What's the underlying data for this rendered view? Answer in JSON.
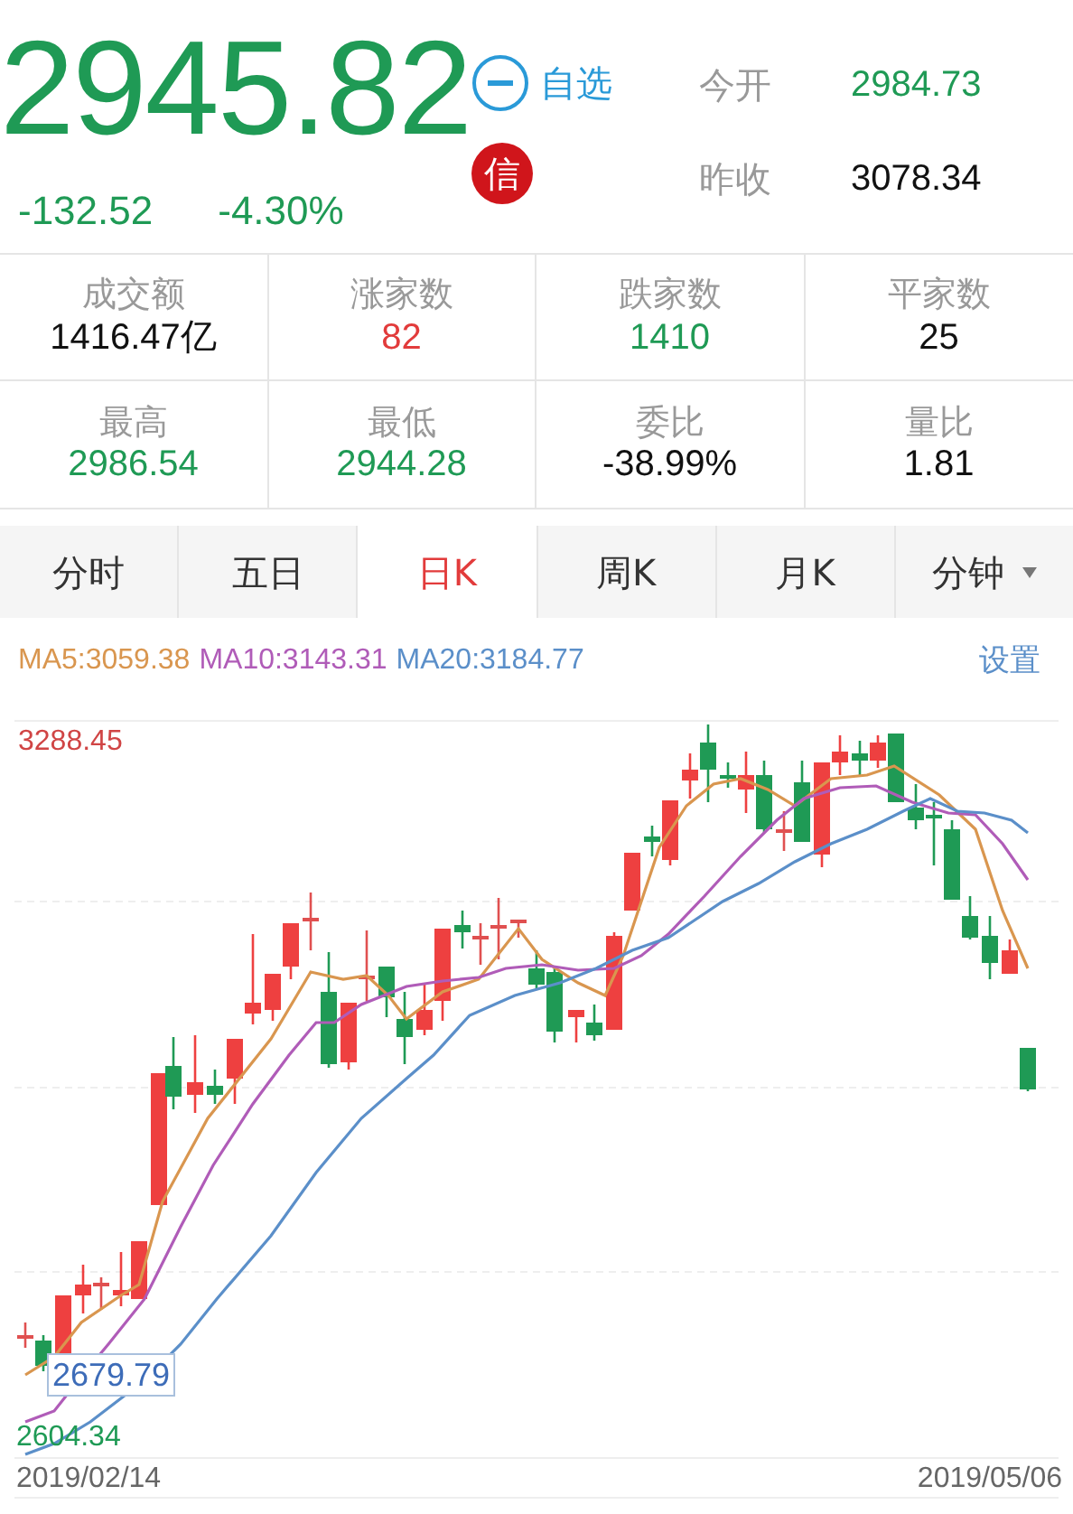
{
  "quote": {
    "price": "2945.82",
    "change": "-132.52",
    "change_pct": "-4.30%",
    "color": "#1f9a55",
    "watchlist_label": "自选",
    "badge": "信",
    "side": [
      {
        "label": "今开",
        "value": "2984.73",
        "color": "#1f9a55"
      },
      {
        "label": "昨收",
        "value": "3078.34",
        "color": "#111111"
      }
    ]
  },
  "stats": [
    {
      "label": "成交额",
      "value": "1416.47亿",
      "color": "#111111"
    },
    {
      "label": "涨家数",
      "value": "82",
      "color": "#e23b3b"
    },
    {
      "label": "跌家数",
      "value": "1410",
      "color": "#1f9a55"
    },
    {
      "label": "平家数",
      "value": "25",
      "color": "#111111"
    },
    {
      "label": "最高",
      "value": "2986.54",
      "color": "#1f9a55"
    },
    {
      "label": "最低",
      "value": "2944.28",
      "color": "#1f9a55"
    },
    {
      "label": "委比",
      "value": "-38.99%",
      "color": "#111111"
    },
    {
      "label": "量比",
      "value": "1.81",
      "color": "#111111"
    }
  ],
  "tabs": [
    {
      "label": "分时",
      "selected": false,
      "has_menu": false
    },
    {
      "label": "五日",
      "selected": false,
      "has_menu": false
    },
    {
      "label": "日K",
      "selected": true,
      "has_menu": false
    },
    {
      "label": "周K",
      "selected": false,
      "has_menu": false
    },
    {
      "label": "月K",
      "selected": false,
      "has_menu": false
    },
    {
      "label": "分钟",
      "selected": false,
      "has_menu": true
    }
  ],
  "moving_averages": [
    {
      "label": "MA5:3059.38",
      "color": "#d9964f"
    },
    {
      "label": "MA10:3143.31",
      "color": "#b05cb8"
    },
    {
      "label": "MA20:3184.77",
      "color": "#5b8fc9"
    }
  ],
  "settings_label": "设置",
  "chart": {
    "high_label": "3288.45",
    "low_label": "2604.34",
    "min_marker": "2679.79",
    "start_date": "2019/02/14",
    "end_date": "2019/05/06"
  }
}
